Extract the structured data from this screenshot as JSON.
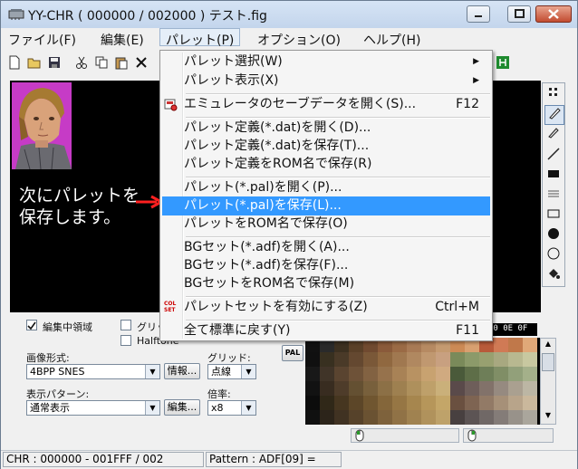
{
  "window": {
    "title": "YY-CHR ( 000000 / 002000 ) テスト.fig"
  },
  "menubar": {
    "items": [
      "ファイル(F)",
      "編集(E)",
      "パレット(P)",
      "オプション(O)",
      "ヘルプ(H)"
    ]
  },
  "instruction": {
    "line1": "次にパレットを",
    "line2": "保存します。",
    "arrow_color": "#ff2020"
  },
  "palette_menu": {
    "items": [
      {
        "label": "パレット選択(W)",
        "submenu": true
      },
      {
        "label": "パレット表示(X)",
        "submenu": true
      },
      {
        "label": "エミュレータのセーブデータを開く(S)...",
        "shortcut": "F12",
        "icon": "emulator-save-icon"
      },
      {
        "label": "パレット定義(*.dat)を開く(D)..."
      },
      {
        "label": "パレット定義(*.dat)を保存(T)..."
      },
      {
        "label": "パレット定義をROM名で保存(R)"
      },
      {
        "label": "パレット(*.pal)を開く(P)..."
      },
      {
        "label": "パレット(*.pal)を保存(L)...",
        "highlighted": true
      },
      {
        "label": "パレットをROM名で保存(O)"
      },
      {
        "label": "BGセット(*.adf)を開く(A)..."
      },
      {
        "label": "BGセット(*.adf)を保存(F)..."
      },
      {
        "label": "BGセットをROM名で保存(M)"
      },
      {
        "label": "パレットセットを有効にする(Z)",
        "shortcut": "Ctrl+M",
        "icon": "colset-icon"
      },
      {
        "label": "全て標準に戻す(Y)",
        "shortcut": "F11"
      }
    ],
    "colset_icon_text": [
      "COL",
      "SET"
    ],
    "highlight_color": "#3399ff"
  },
  "lower_panel": {
    "edit_region_label": "編集中領域",
    "edit_region_checked": true,
    "grid_label": "グリッ",
    "halftone_label": "Halftone",
    "format_label": "画像形式:",
    "format_value": "4BPP SNES",
    "info_button": "情報...",
    "grid_type_label": "グリッド:",
    "grid_type_value": "点線",
    "pattern_label": "表示パターン:",
    "pattern_value": "通常表示",
    "edit_button": "編集...",
    "zoom_label": "倍率:",
    "zoom_value": "x8",
    "pal_button": "PAL",
    "palette_header": "00 0E 0F"
  },
  "palette_colors": [
    "#111111",
    "#2a2a2a",
    "#3c3020",
    "#5a4028",
    "#704a30",
    "#8a5a3a",
    "#9a6a45",
    "#a87a55",
    "#b68a62",
    "#c49a70",
    "#cc8a55",
    "#d8a070",
    "#b85a3a",
    "#d07a55",
    "#c0784a",
    "#e0a878",
    "#101010",
    "#383020",
    "#4a3a28",
    "#644830",
    "#7a5838",
    "#906840",
    "#a07850",
    "#b08860",
    "#c09870",
    "#c8a080",
    "#7a8a5a",
    "#8c9a6a",
    "#98a070",
    "#a8a880",
    "#b8b890",
    "#c8c8a0",
    "#181818",
    "#403428",
    "#5a4430",
    "#6e5238",
    "#826242",
    "#96724c",
    "#a88256",
    "#b89262",
    "#c8a270",
    "#d0aa80",
    "#4a5a3a",
    "#5e6e48",
    "#6e7e58",
    "#808e66",
    "#92a07a",
    "#a4b08a",
    "#121212",
    "#382c20",
    "#4e3c2a",
    "#645032",
    "#78603c",
    "#8c7046",
    "#9e8050",
    "#ae905c",
    "#bea06a",
    "#cab07a",
    "#5a4a4a",
    "#6e5e5a",
    "#82726a",
    "#968a80",
    "#aaa090",
    "#bcb6a4",
    "#0c0c0c",
    "#302818",
    "#463620",
    "#5c4628",
    "#705630",
    "#84663a",
    "#967644",
    "#a6864e",
    "#b6965a",
    "#c4a668",
    "#6a5040",
    "#7e6452",
    "#927a66",
    "#a69078",
    "#b8a48a",
    "#cab89c",
    "#101010",
    "#2c241a",
    "#403222",
    "#56422a",
    "#6a5232",
    "#7e623c",
    "#907246",
    "#a08250",
    "#b0925c",
    "#bea26a",
    "#484040",
    "#5c5454",
    "#706866",
    "#847c78",
    "#98928a",
    "#aaa69c"
  ],
  "status": {
    "chr": "CHR : 000000 - 001FFF / 002",
    "pattern": "Pattern : ADF[09] ="
  }
}
